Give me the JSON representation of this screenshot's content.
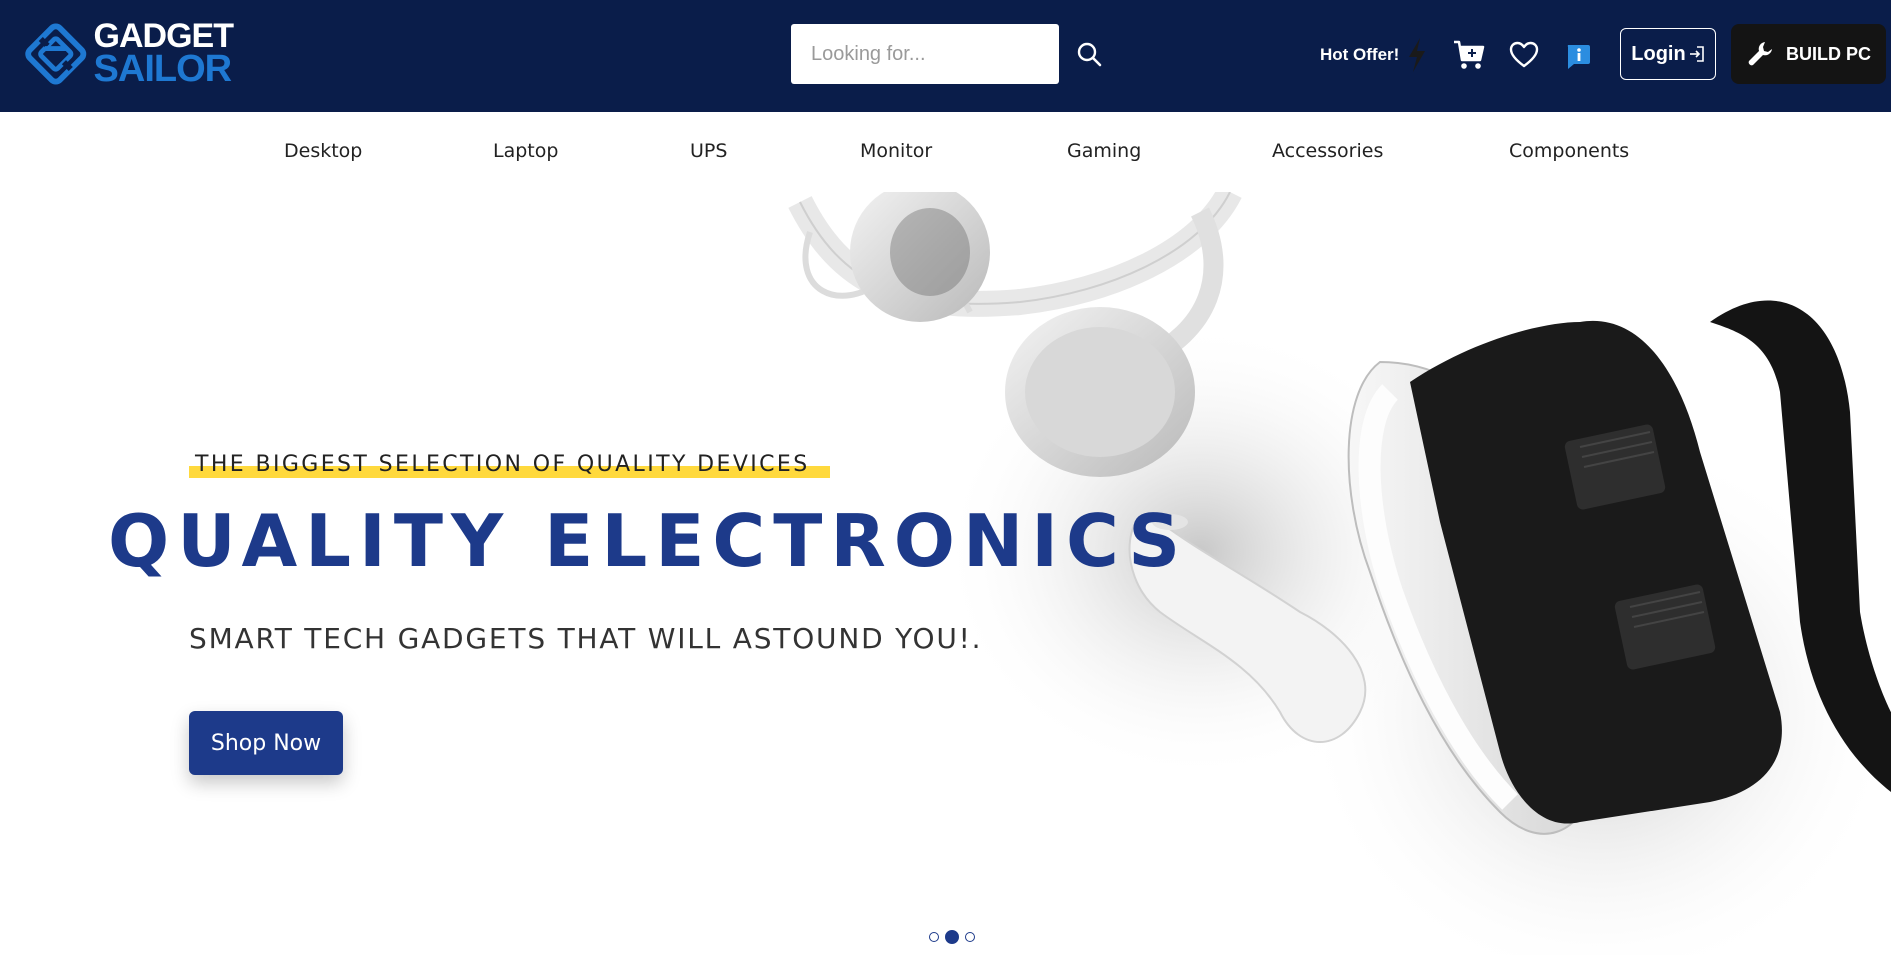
{
  "brand": {
    "line1": "GADGET",
    "line2": "SAILOR",
    "primary_color": "#0a1d4a",
    "accent_color": "#1e78d2"
  },
  "header": {
    "search": {
      "placeholder": "Looking for...",
      "value": "",
      "icon": "search-icon"
    },
    "hot_offer": {
      "label": "Hot Offer!",
      "icon": "lightning-icon"
    },
    "cart_icon": "cart-icon",
    "wishlist_icon": "heart-icon",
    "info_icon": "info-icon",
    "login": {
      "label": "Login",
      "icon": "login-icon"
    },
    "build_pc": {
      "label": "BUILD PC",
      "icon": "wrench-icon"
    }
  },
  "nav": {
    "items": [
      "Desktop",
      "Laptop",
      "UPS",
      "Monitor",
      "Gaming",
      "Accessories",
      "Components"
    ]
  },
  "hero": {
    "eyebrow": "THE BIGGEST SELECTION OF QUALITY DEVICES",
    "headline": "QUALITY ELECTRONICS",
    "subhead": "SMART TECH GADGETS THAT WILL ASTOUND YOU!.",
    "cta": "Shop Now",
    "highlight_color": "#ffd93d",
    "headline_color": "#1d3a8a",
    "slides_total": 3,
    "active_slide": 2
  }
}
